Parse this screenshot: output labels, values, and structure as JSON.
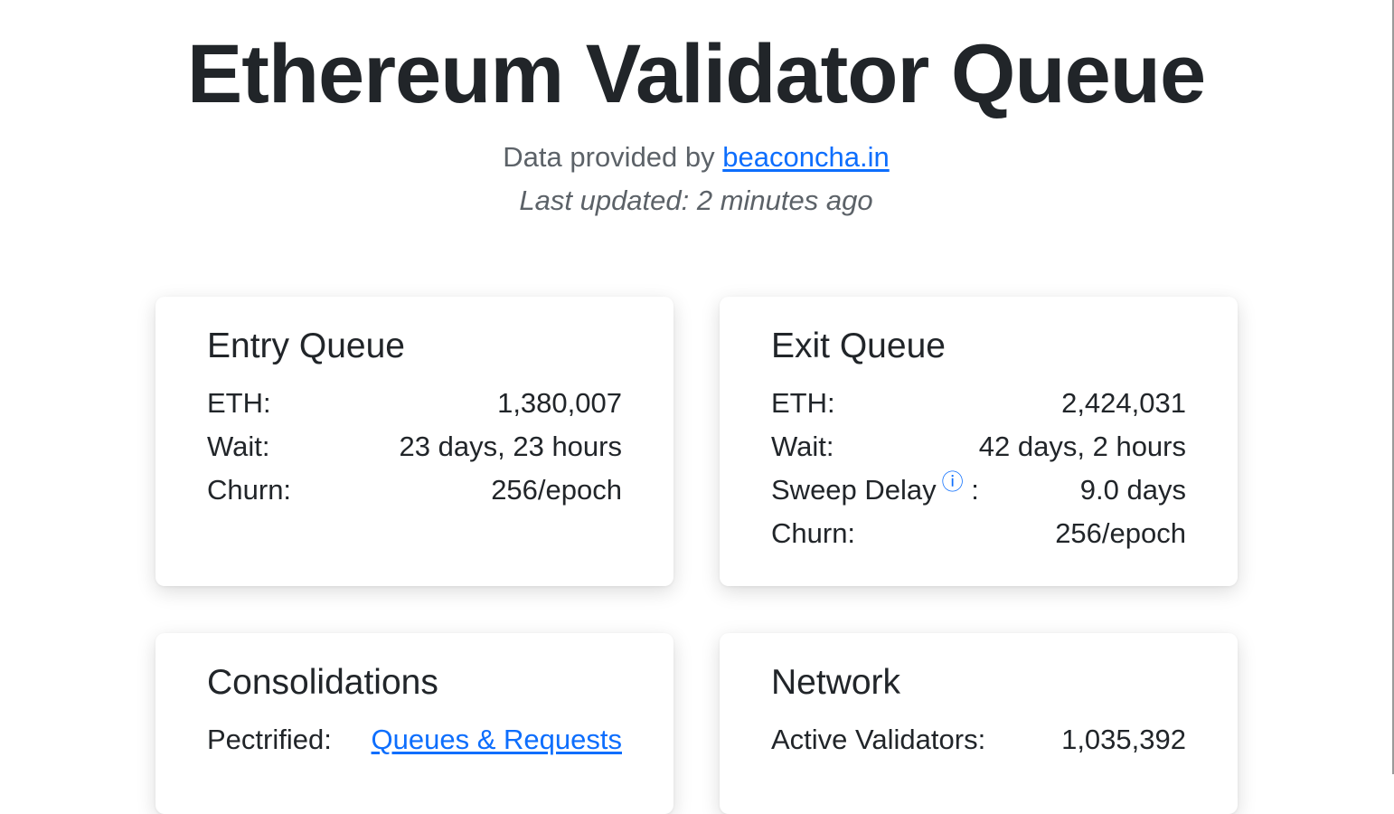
{
  "header": {
    "title": "Ethereum Validator Queue",
    "provided_prefix": "Data provided by",
    "provider_link": "beaconcha.in",
    "last_updated": "Last updated: 2 minutes ago"
  },
  "entry_queue": {
    "title": "Entry Queue",
    "rows": [
      {
        "label": "ETH:",
        "value": "1,380,007"
      },
      {
        "label": "Wait:",
        "value": "23 days, 23 hours"
      },
      {
        "label": "Churn:",
        "value": "256/epoch"
      }
    ]
  },
  "exit_queue": {
    "title": "Exit Queue",
    "eth_label": "ETH:",
    "eth_value": "2,424,031",
    "wait_label": "Wait:",
    "wait_value": "42 days, 2 hours",
    "sweep_label": "Sweep Delay",
    "sweep_icon": "ⓘ",
    "sweep_colon": ":",
    "sweep_value": "9.0 days",
    "churn_label": "Churn:",
    "churn_value": "256/epoch"
  },
  "consolidations": {
    "title": "Consolidations",
    "label": "Pectrified:",
    "link": "Queues & Requests"
  },
  "network": {
    "title": "Network",
    "label": "Active Validators:",
    "value": "1,035,392"
  },
  "colors": {
    "link": "#0d6efd",
    "text": "#212529",
    "muted": "#5c6268"
  }
}
